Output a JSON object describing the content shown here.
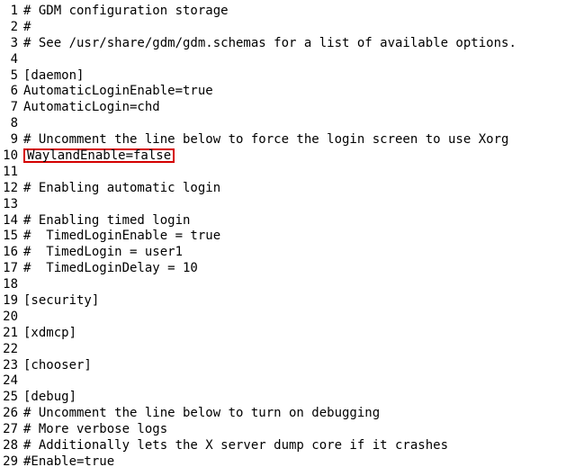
{
  "editor": {
    "lines": [
      {
        "n": 1,
        "text": "# GDM configuration storage",
        "highlight": false
      },
      {
        "n": 2,
        "text": "#",
        "highlight": false
      },
      {
        "n": 3,
        "text": "# See /usr/share/gdm/gdm.schemas for a list of available options.",
        "highlight": false
      },
      {
        "n": 4,
        "text": "",
        "highlight": false
      },
      {
        "n": 5,
        "text": "[daemon]",
        "highlight": false
      },
      {
        "n": 6,
        "text": "AutomaticLoginEnable=true",
        "highlight": false
      },
      {
        "n": 7,
        "text": "AutomaticLogin=chd",
        "highlight": false
      },
      {
        "n": 8,
        "text": "",
        "highlight": false
      },
      {
        "n": 9,
        "text": "# Uncomment the line below to force the login screen to use Xorg",
        "highlight": false
      },
      {
        "n": 10,
        "text": "WaylandEnable=false",
        "highlight": true
      },
      {
        "n": 11,
        "text": "",
        "highlight": false
      },
      {
        "n": 12,
        "text": "# Enabling automatic login",
        "highlight": false
      },
      {
        "n": 13,
        "text": "",
        "highlight": false
      },
      {
        "n": 14,
        "text": "# Enabling timed login",
        "highlight": false
      },
      {
        "n": 15,
        "text": "#  TimedLoginEnable = true",
        "highlight": false
      },
      {
        "n": 16,
        "text": "#  TimedLogin = user1",
        "highlight": false
      },
      {
        "n": 17,
        "text": "#  TimedLoginDelay = 10",
        "highlight": false
      },
      {
        "n": 18,
        "text": "",
        "highlight": false
      },
      {
        "n": 19,
        "text": "[security]",
        "highlight": false
      },
      {
        "n": 20,
        "text": "",
        "highlight": false
      },
      {
        "n": 21,
        "text": "[xdmcp]",
        "highlight": false
      },
      {
        "n": 22,
        "text": "",
        "highlight": false
      },
      {
        "n": 23,
        "text": "[chooser]",
        "highlight": false
      },
      {
        "n": 24,
        "text": "",
        "highlight": false
      },
      {
        "n": 25,
        "text": "[debug]",
        "highlight": false
      },
      {
        "n": 26,
        "text": "# Uncomment the line below to turn on debugging",
        "highlight": false
      },
      {
        "n": 27,
        "text": "# More verbose logs",
        "highlight": false
      },
      {
        "n": 28,
        "text": "# Additionally lets the X server dump core if it crashes",
        "highlight": false
      },
      {
        "n": 29,
        "text": "#Enable=true",
        "highlight": false
      }
    ]
  }
}
